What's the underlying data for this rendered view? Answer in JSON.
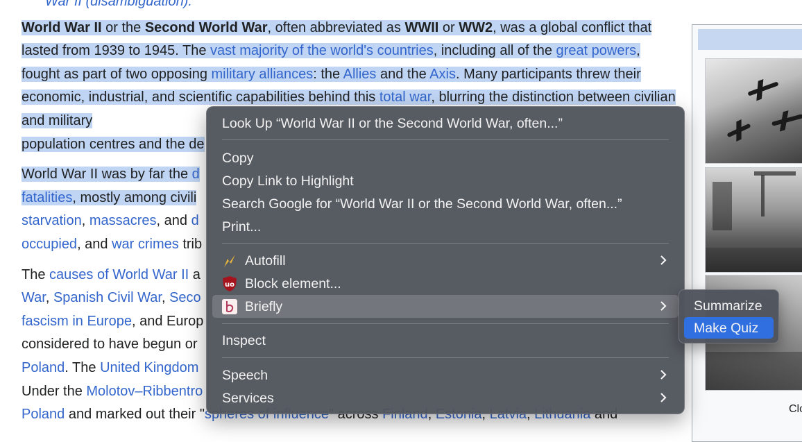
{
  "article": {
    "hatnote": "War II (disambiguation).",
    "p1": {
      "b1": "World War II",
      "t1": " or the ",
      "b2": "Second World War",
      "t2": ", often abbreviated as ",
      "b3": "WWII",
      "t3": " or ",
      "b4": "WW2",
      "t4": ", was a global conflict that lasted from 1939 to 1945. The ",
      "l1": "vast majority of the world's countries",
      "t5": ", including all of the ",
      "l2": "great powers",
      "t6": ", fought as part of two opposing ",
      "l3": "military alliances",
      "t7": ": the ",
      "l4": "Allies",
      "t8": " and the ",
      "l5": "Axis",
      "t9": ". Many participants threw their economic, industrial, and scientific capabilities behind this ",
      "l6": "total war",
      "t10": ", blurring the distinction between civilian and military",
      "t11": "population centres and the de"
    },
    "p2": {
      "t1": "World War II was by far the ",
      "l1": "d",
      "l2": "fatalities",
      "t2": ", mostly among civili",
      "l3": "starvation",
      "t3": ", ",
      "l4": "massacres",
      "t4": ", and ",
      "l5": "d",
      "l6": "occupied",
      "t5": ", and ",
      "l7": "war crimes",
      "t6": " trib"
    },
    "p3": {
      "t1": "The ",
      "l1": "causes of World War II",
      "t2": " a",
      "l2": "War",
      "t3": ", ",
      "l3": "Spanish Civil War",
      "t4": ", ",
      "l4": "Seco",
      "l5": "fascism in Europe",
      "t5": ", and Europ",
      "t6": "considered to have begun or",
      "l6": "Poland",
      "t7": ". The ",
      "l7": "United Kingdom",
      "t8": "Under the ",
      "l8": "Molotov–Ribbentro",
      "l9": "Poland",
      "t9": " and marked out their \"",
      "l10": "spheres of influence",
      "t10": "\" across ",
      "l11": "Finland",
      "t11": ", ",
      "l12": "Estonia",
      "t12": ", ",
      "l13": "Latvia",
      "t13": ", ",
      "l14": "Lithuania",
      "t14": " and"
    }
  },
  "infobox": {
    "caption_fragment": "Clo"
  },
  "context_menu": {
    "look_up": "Look Up “World War II or the Second World War, often...”",
    "copy": "Copy",
    "copy_link": "Copy Link to Highlight",
    "search_google": "Search Google for “World War II or the Second World War, often...”",
    "print": "Print...",
    "autofill": "Autofill",
    "block_element": "Block element...",
    "briefly": "Briefly",
    "inspect": "Inspect",
    "speech": "Speech",
    "services": "Services"
  },
  "submenu": {
    "summarize": "Summarize",
    "make_quiz": "Make Quiz"
  },
  "colors": {
    "link": "#3366cc",
    "selection": "#c0d5f4",
    "menu_bg": "#50545c",
    "active": "#2f6fe0"
  },
  "icons": {
    "autofill": "lightning-icon",
    "block_element": "ublock-shield-icon",
    "briefly": "briefly-b-icon",
    "submenu": "chevron-right-icon"
  }
}
